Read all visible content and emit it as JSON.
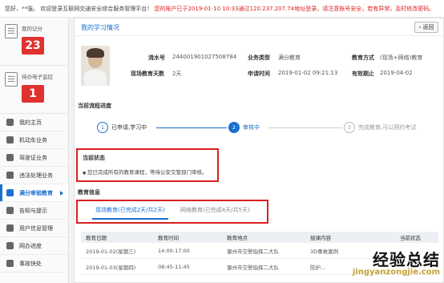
{
  "topbar": {
    "greeting": "您好，**強。 欢迎登录互联网交通安全综合服务管理平台！",
    "warning": "您的账户已于2019-01-10 10:33通过120.237.207.74地址登录，请注意账号安全，若有异常，及时修改密码。"
  },
  "sidebar": {
    "score_label": "我的记分",
    "score_value": "23",
    "monitor_label": "待办电子监控",
    "monitor_value": "1",
    "items": [
      {
        "label": "我的主页",
        "icon": "home-icon"
      },
      {
        "label": "机动车业务",
        "icon": "car-icon"
      },
      {
        "label": "驾驶证业务",
        "icon": "license-icon"
      },
      {
        "label": "违法处理业务",
        "icon": "camera-icon"
      },
      {
        "label": "满分审验教育",
        "icon": "book-icon"
      },
      {
        "label": "告知与提示",
        "icon": "bell-icon"
      },
      {
        "label": "用户信息管理",
        "icon": "user-icon"
      },
      {
        "label": "网办进度",
        "icon": "progress-icon"
      },
      {
        "label": "事故快处",
        "icon": "accident-icon"
      }
    ],
    "active_index": 4
  },
  "main": {
    "title": "我的学习情况",
    "back_label": "返回",
    "info": {
      "serial_label": "流水号",
      "serial_value": "244001901027508784",
      "biztype_label": "业务类型",
      "biztype_value": "满分教育",
      "method_label": "教育方式",
      "method_value": "(现场+网络)教育",
      "days_label": "现场教育天数",
      "days_value": "2天",
      "applytime_label": "申请时间",
      "applytime_value": "2019-01-02 09:21:13",
      "expire_label": "有效期止",
      "expire_value": "2019-04-02"
    },
    "progress_title": "当前流程进度",
    "steps": [
      {
        "num": "1",
        "label": "已申请,学习中",
        "state": "done"
      },
      {
        "num": "2",
        "label": "审核中",
        "state": "current"
      },
      {
        "num": "3",
        "label": "完成教育,可以预约考试",
        "state": "todo"
      }
    ],
    "status_title": "当前状态",
    "status_text": "您已完成所有的教育课程，等待公安交管部门审核。",
    "edu_title": "教育信息",
    "tabs": [
      {
        "label": "现场教育(已完成2天/共2天)",
        "active": true
      },
      {
        "label": "网络教育(已完成4天/共5天)",
        "active": false
      }
    ],
    "table": {
      "headers": [
        "教育日期",
        "教育时间",
        "教育地点",
        "授课内容",
        "当前状态"
      ],
      "rows": [
        [
          "2019-01-02(星期三)",
          "14:00-17:00",
          "肇州市交警指挥二大队",
          "3D事故案例",
          ""
        ],
        [
          "2019-01-03(星期四)",
          "08:45-11:45",
          "肇州市交警指挥二大队",
          "防护...",
          ""
        ]
      ]
    }
  },
  "watermark": {
    "line1": "经验总结",
    "line2": "jingyanzongjie.com"
  },
  "colors": {
    "accent": "#1b6fcf",
    "alert": "#d92020",
    "score": "#e0312f"
  }
}
